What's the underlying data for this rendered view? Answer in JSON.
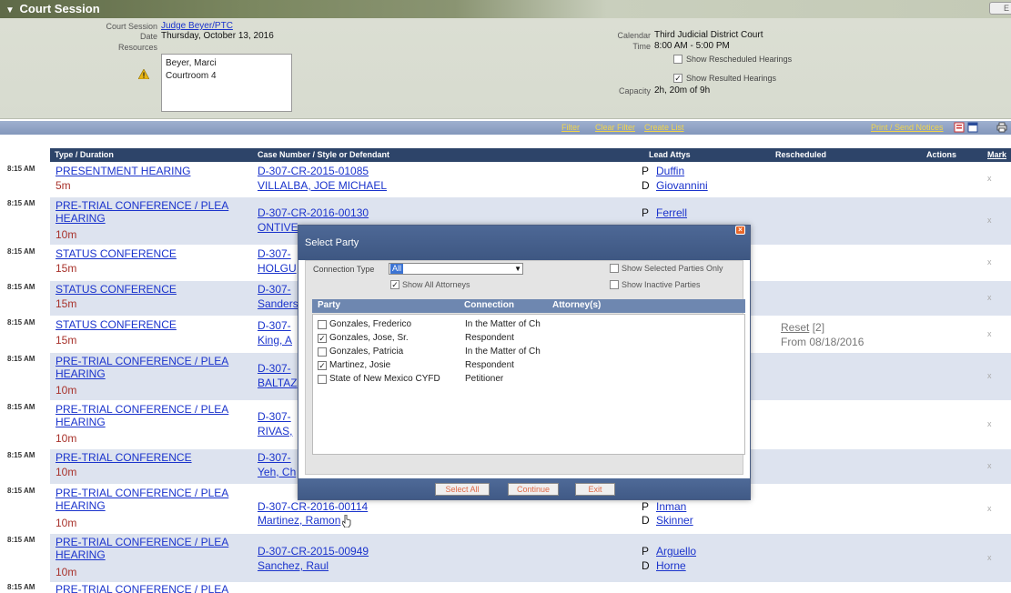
{
  "banner": {
    "title": "Court Session",
    "exit_label": "E",
    "court_session_label": "Court Session",
    "court_session_value": "Judge Beyer/PTC",
    "date_label": "Date",
    "date_value": "Thursday, October 13, 2016",
    "resources_label": "Resources",
    "resources": [
      "Beyer, Marci",
      "Courtroom 4"
    ],
    "calendar_label": "Calendar",
    "calendar_value": "Third Judicial District Court",
    "time_label": "Time",
    "time_value": "8:00 AM - 5:00 PM",
    "show_rescheduled_label": "Show Rescheduled Hearings",
    "show_rescheduled_checked": false,
    "show_resulted_label": "Show Resulted Hearings",
    "show_resulted_checked": true,
    "capacity_label": "Capacity",
    "capacity_value": "2h, 20m of 9h"
  },
  "toolbar": {
    "filter": "Filter",
    "clear_filter": "Clear Filter",
    "create_list": "Create List",
    "print_send": "Print / Send Notices"
  },
  "columns": {
    "type": "Type / Duration",
    "case": "Case Number / Style or Defendant",
    "attys": "Lead Attys",
    "rescheduled": "Rescheduled",
    "actions": "Actions",
    "mark": "Mark"
  },
  "rows": [
    {
      "time": "8:15 AM",
      "type": "PRESENTMENT HEARING",
      "duration": "5m",
      "case": "D-307-CR-2015-01085",
      "defendant": "VILLALBA, JOE MICHAEL",
      "atty_p": "Duffin",
      "atty_d": "Giovannini",
      "x": "x"
    },
    {
      "time": "8:15 AM",
      "type": "PRE-TRIAL CONFERENCE / PLEA HEARING",
      "duration": "10m",
      "case": "D-307-CR-2016-00130",
      "defendant": "ONTIVE",
      "atty_p": "Ferrell",
      "x": "x"
    },
    {
      "time": "8:15 AM",
      "type": "STATUS CONFERENCE",
      "duration": "15m",
      "case": "D-307-",
      "defendant": "HOLGU",
      "x": "x"
    },
    {
      "time": "8:15 AM",
      "type": "STATUS CONFERENCE",
      "duration": "15m",
      "case": "D-307-",
      "defendant": "Sanders",
      "x": "x"
    },
    {
      "time": "8:15 AM",
      "type": "STATUS CONFERENCE",
      "duration": "15m",
      "case": "D-307-",
      "defendant": "King, A",
      "reset": "Reset",
      "reset_count": "[2]",
      "from": "From 08/18/2016",
      "x": "x"
    },
    {
      "time": "8:15 AM",
      "type": "PRE-TRIAL CONFERENCE / PLEA HEARING",
      "duration": "10m",
      "case": "D-307-",
      "defendant": "BALTAZ",
      "x": "x"
    },
    {
      "time": "8:15 AM",
      "type": "PRE-TRIAL CONFERENCE / PLEA HEARING",
      "duration": "10m",
      "case": "D-307-",
      "defendant": "RIVAS,",
      "x": "x"
    },
    {
      "time": "8:15 AM",
      "type": "PRE-TRIAL CONFERENCE",
      "duration": "10m",
      "case": "D-307-",
      "defendant": "Yeh, Ch",
      "x": "x"
    },
    {
      "time": "8:15 AM",
      "type": "PRE-TRIAL CONFERENCE / PLEA HEARING",
      "duration": "10m",
      "case": "D-307-CR-2016-00114",
      "defendant": "Martinez, Ramon",
      "atty_p": "Inman",
      "atty_d": "Skinner",
      "x": "x"
    },
    {
      "time": "8:15 AM",
      "type": "PRE-TRIAL CONFERENCE / PLEA HEARING",
      "duration": "10m",
      "case": "D-307-CR-2015-00949",
      "defendant": "Sanchez, Raul",
      "atty_p": "Arguello",
      "atty_d": "Horne",
      "x": "x"
    },
    {
      "time": "8:15 AM",
      "type": "PRE-TRIAL CONFERENCE / PLEA"
    }
  ],
  "atty_roles": {
    "p": "P",
    "d": "D"
  },
  "modal": {
    "title": "Select Party",
    "connection_type_label": "Connection Type",
    "connection_type_value": "All",
    "show_all_attorneys": "Show All Attorneys",
    "show_all_attorneys_checked": true,
    "show_selected_only": "Show Selected Parties Only",
    "show_selected_only_checked": false,
    "show_inactive": "Show Inactive Parties",
    "show_inactive_checked": false,
    "col_party": "Party",
    "col_connection": "Connection",
    "col_attorneys": "Attorney(s)",
    "parties": [
      {
        "name": "Gonzales, Frederico",
        "connection": "In the Matter of Ch",
        "checked": false
      },
      {
        "name": "Gonzales, Jose, Sr.",
        "connection": "Respondent",
        "checked": true
      },
      {
        "name": "Gonzales, Patricia",
        "connection": "In the Matter of Ch",
        "checked": false
      },
      {
        "name": "Martinez, Josie",
        "connection": "Respondent",
        "checked": true
      },
      {
        "name": "State of New Mexico CYFD",
        "connection": "Petitioner",
        "checked": false
      }
    ],
    "select_all": "Select All",
    "continue": "Continue",
    "exit": "Exit"
  },
  "colors": {
    "link": "#1a33cc",
    "duration": "#a8322b",
    "header_navy": "#2d4469",
    "toolbar_link": "#f2d54a",
    "modal_title": "#4d6896",
    "button_text": "#e06b48"
  },
  "icons": {
    "warning": "warning-icon",
    "close": "close-icon",
    "print": "printer-icon",
    "notice": "notice-icon",
    "calendar": "calendar-icon",
    "cursor": "pointer-cursor"
  }
}
